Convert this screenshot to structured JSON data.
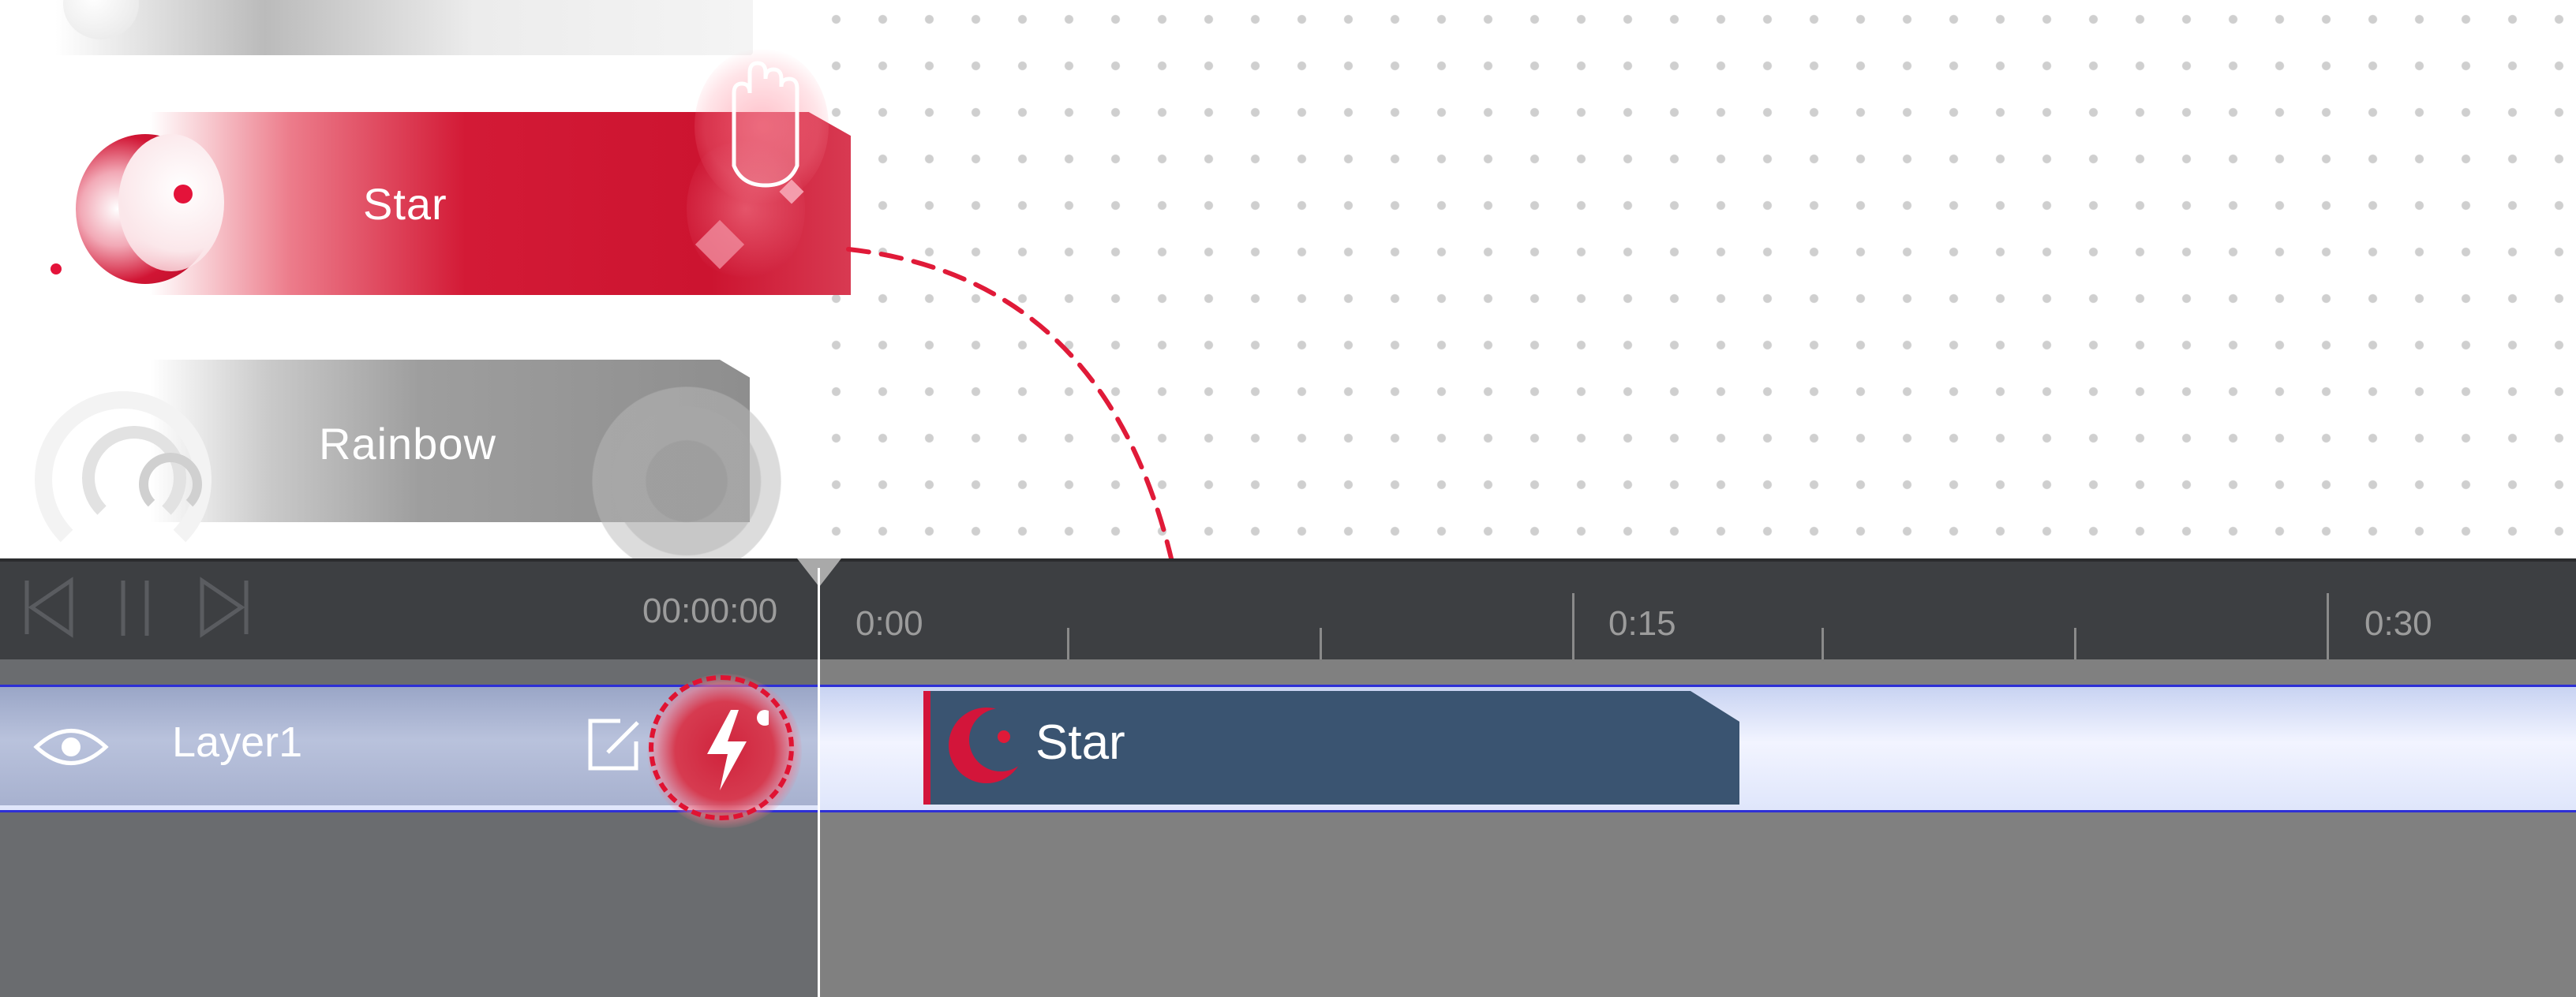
{
  "effects_panel": {
    "cards": [
      {
        "label": "Star",
        "state": "dragging"
      },
      {
        "label": "Rainbow",
        "state": "idle"
      }
    ]
  },
  "timeline": {
    "current_time": "00:00:00",
    "ruler_labels": [
      "0:00",
      "0:15",
      "0:30"
    ],
    "layers": [
      {
        "name": "Layer1",
        "clips": [
          {
            "label": "Star"
          }
        ]
      }
    ]
  },
  "colors": {
    "accent_red": "#d31a36",
    "clip_blue": "#3a5471",
    "timeline_dark": "#3d3f42",
    "selection_blue": "#2d2fd6"
  },
  "icons": [
    "hand-cursor-icon",
    "eye-icon",
    "edit-icon",
    "lightning-icon",
    "skip-back-icon",
    "pause-icon",
    "skip-forward-icon"
  ]
}
